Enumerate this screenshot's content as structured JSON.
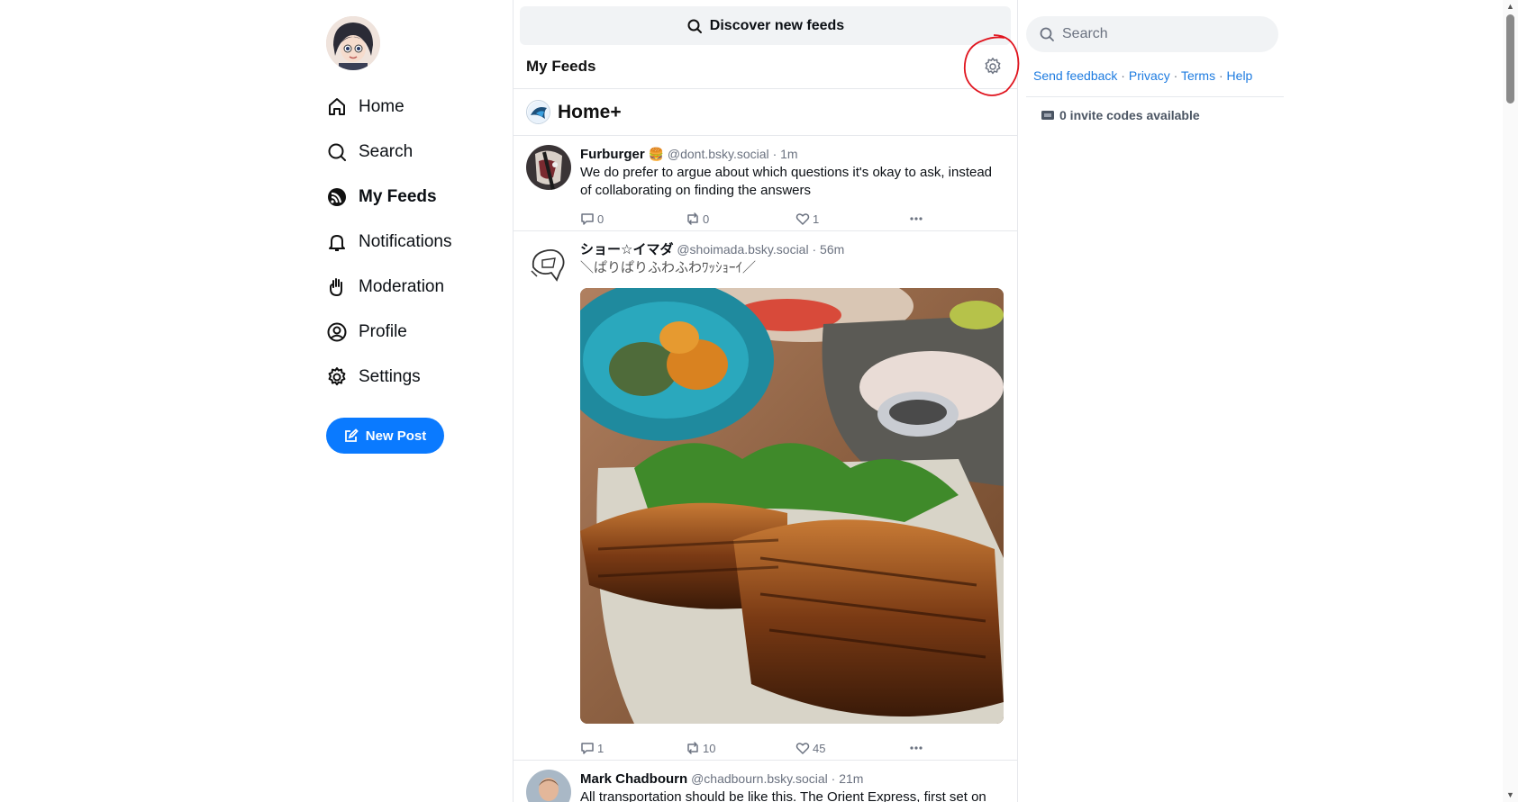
{
  "nav": {
    "items": [
      {
        "label": "Home",
        "icon": "home-icon",
        "active": false
      },
      {
        "label": "Search",
        "icon": "search-icon",
        "active": false
      },
      {
        "label": "My Feeds",
        "icon": "feeds-icon",
        "active": true
      },
      {
        "label": "Notifications",
        "icon": "bell-icon",
        "active": false
      },
      {
        "label": "Moderation",
        "icon": "hand-icon",
        "active": false
      },
      {
        "label": "Profile",
        "icon": "user-circle-icon",
        "active": false
      },
      {
        "label": "Settings",
        "icon": "gear-icon",
        "active": false
      }
    ],
    "new_post_label": "New Post"
  },
  "center": {
    "discover_label": "Discover new feeds",
    "feeds_title": "My Feeds",
    "feed_name": "Home+",
    "posts": [
      {
        "author": "Furburger",
        "emoji": "🍔",
        "handle": "@dont.bsky.social",
        "time": "1m",
        "text": "We do prefer to argue about which questions it's okay to ask, instead of collaborating on finding the answers",
        "replies": "0",
        "reposts": "0",
        "likes": "1"
      },
      {
        "author": "ショー☆イマダ",
        "handle": "@shoimada.bsky.social",
        "time": "56m",
        "text": "＼ぱりぱりふわふわﾜｯｼｮｰｲ／",
        "replies": "1",
        "reposts": "10",
        "likes": "45"
      },
      {
        "author": "Mark Chadbourn",
        "handle": "@chadbourn.bsky.social",
        "time": "21m",
        "text": "All transportation should be like this. The Orient Express, first set on"
      }
    ]
  },
  "right": {
    "search_placeholder": "Search",
    "links": {
      "feedback": "Send feedback",
      "privacy": "Privacy",
      "terms": "Terms",
      "help": "Help"
    },
    "separator": "·",
    "invite_text": "0 invite codes available"
  },
  "colors": {
    "accent": "#0a7aff",
    "annotation": "#e0141e"
  }
}
